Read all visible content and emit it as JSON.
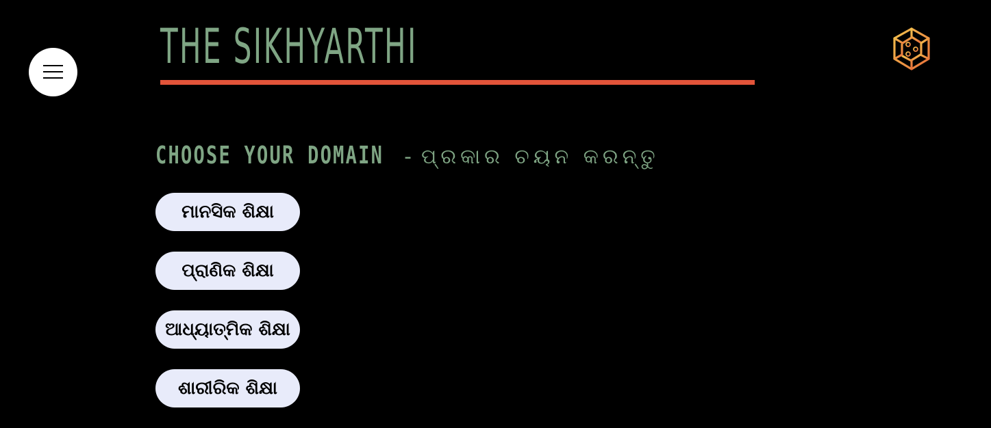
{
  "header": {
    "menu_icon": "hamburger-menu-icon",
    "title": "THE SIKHYARTHI",
    "logo_icon": "hexagon-circuit-logo-icon",
    "rule_color": "#e2543a",
    "title_color": "#7fa584"
  },
  "main": {
    "heading_en": "CHOOSE YOUR DOMAIN",
    "heading_sep": "-",
    "heading_od": "ପ୍ରକାର ଚୟନ କରନ୍ତୁ",
    "domains": [
      {
        "label": "ମାନସିକ ଶିକ୍ଷା"
      },
      {
        "label": "ପ୍ରାଣିକ ଶିକ୍ଷା"
      },
      {
        "label": "ଆଧ୍ୟାତ୍ମିକ ଶିକ୍ଷା"
      },
      {
        "label": "ଶାରୀରିକ ଶିକ୍ଷା"
      }
    ],
    "button_bg": "#e8ebfa"
  }
}
